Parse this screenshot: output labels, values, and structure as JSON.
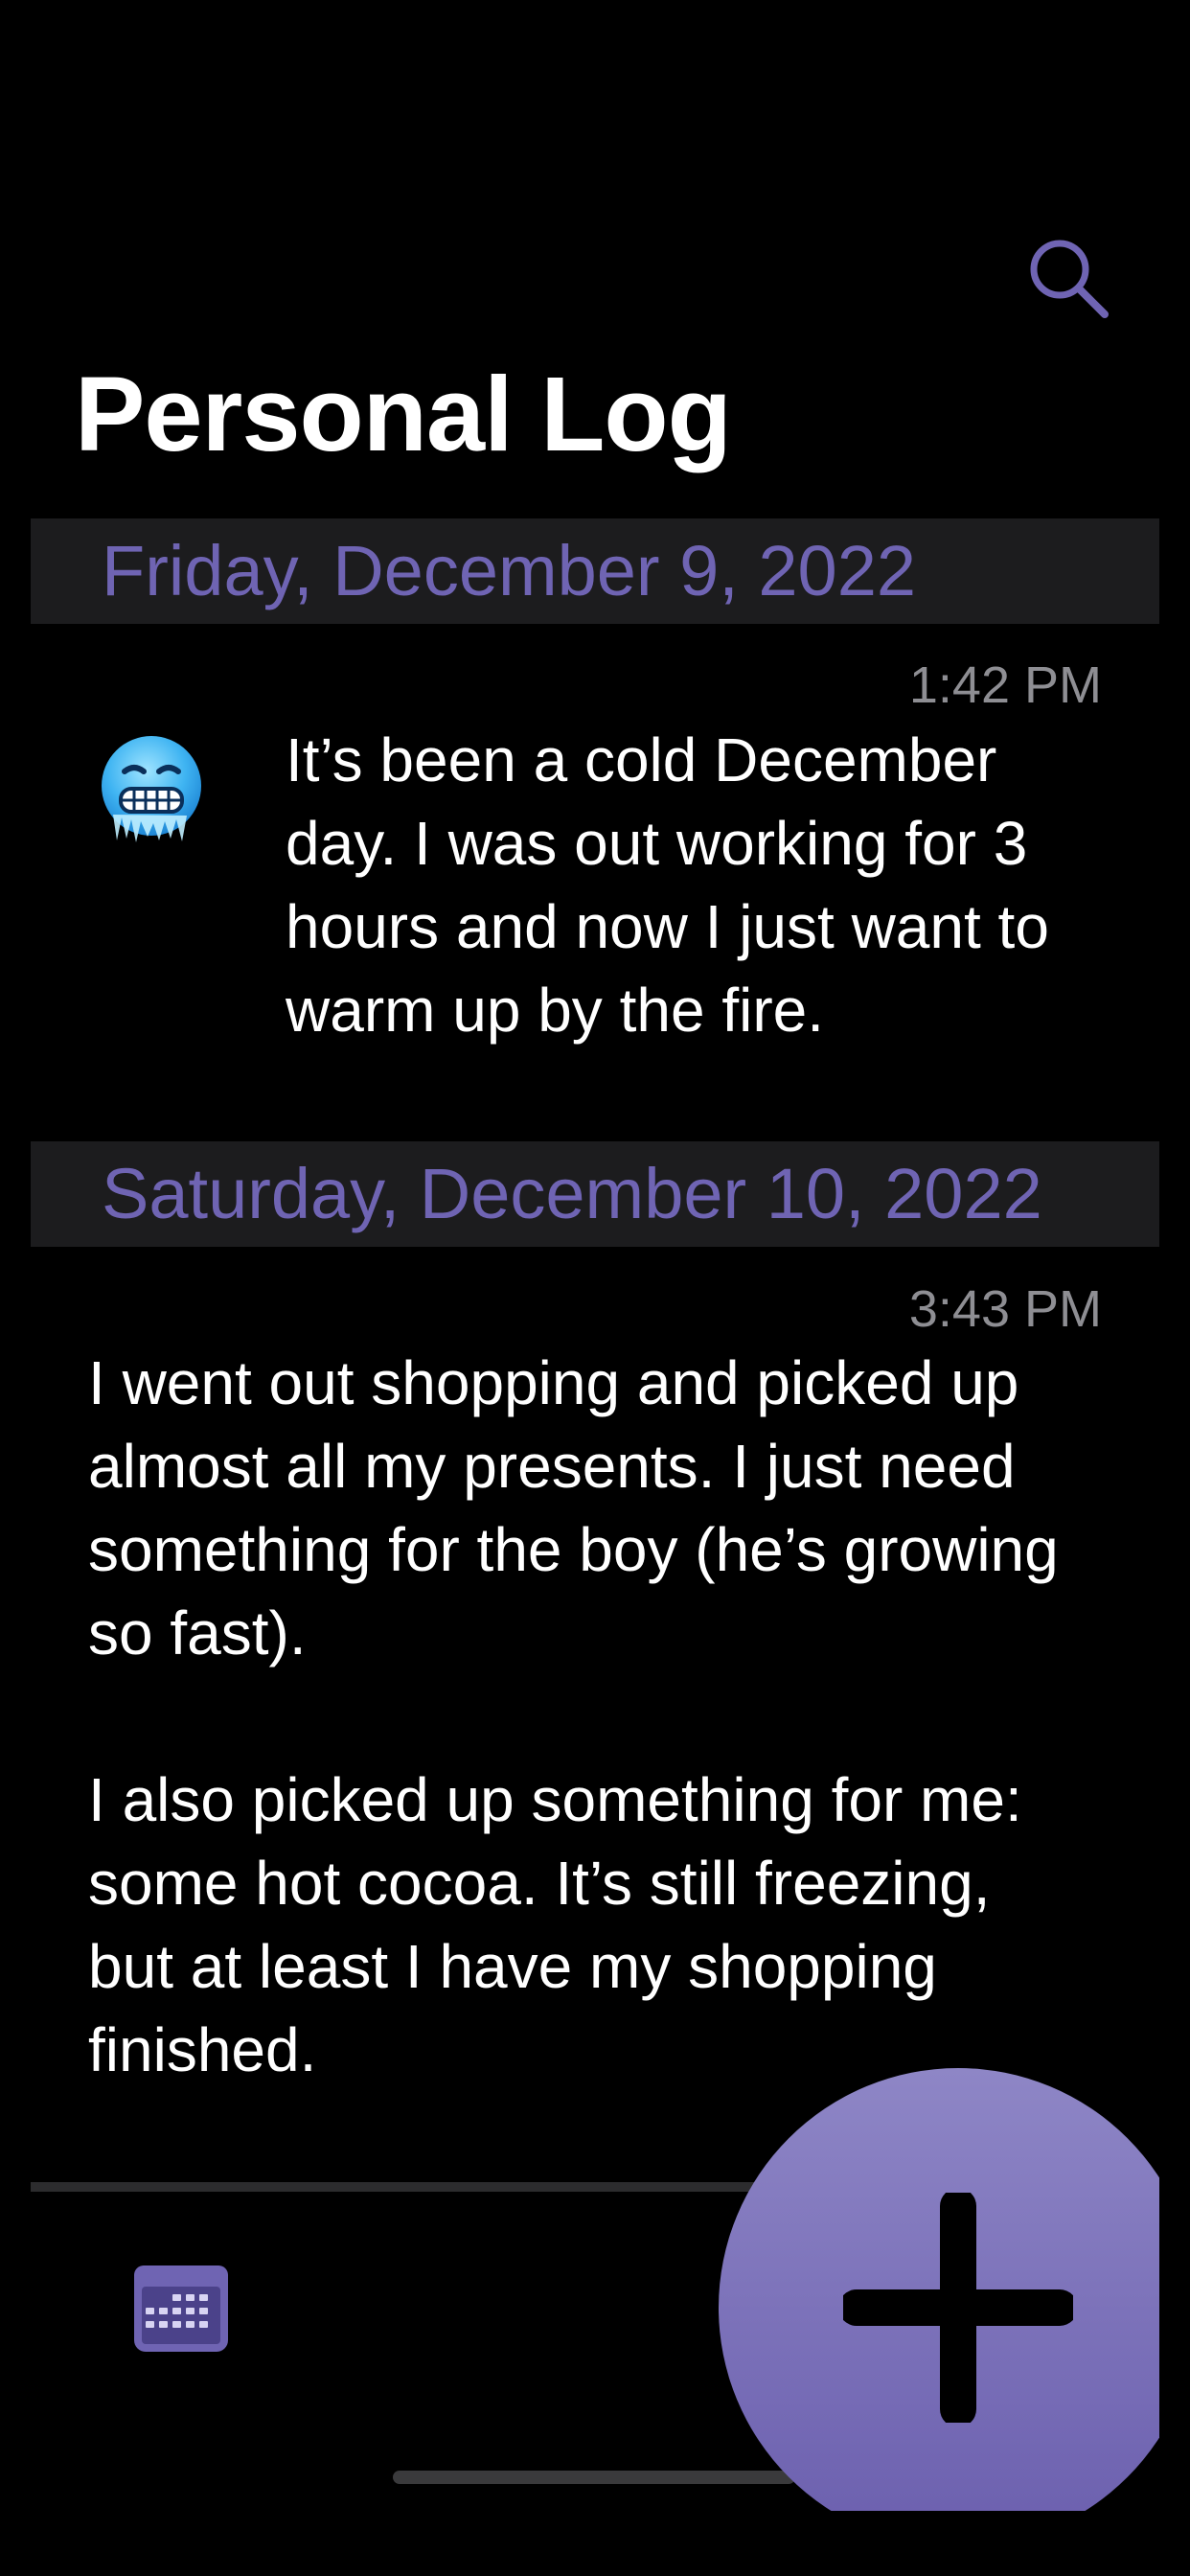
{
  "header": {
    "title": "Personal Log",
    "search_icon": "search-icon"
  },
  "entries": [
    {
      "date": "Friday, December 9, 2022",
      "time": "1:42 PM",
      "emoji": "cold-face-emoji",
      "text": "It’s been a cold December\nday.  I was out working for 3\nhours and now I just want to\nwarm up by the fire."
    },
    {
      "date": "Saturday, December 10, 2022",
      "time": "3:43 PM",
      "text": "I went out shopping and picked up\nalmost all my presents.  I just need\nsomething for the boy (he’s growing\nso fast).\n\nI also picked up something for me:\nsome hot cocoa.  It’s still freezing,\nbut at least I have my shopping\nfinished."
    }
  ],
  "toolbar": {
    "calendar_icon": "calendar-icon",
    "add_icon": "plus-icon"
  },
  "colors": {
    "accent": "#6f64b3",
    "background": "#000000",
    "section_background": "#1c1c1e",
    "timestamp": "#8e8e93",
    "fab_gradient_top": "#8e86c6",
    "fab_gradient_bottom": "#6b5fae"
  }
}
